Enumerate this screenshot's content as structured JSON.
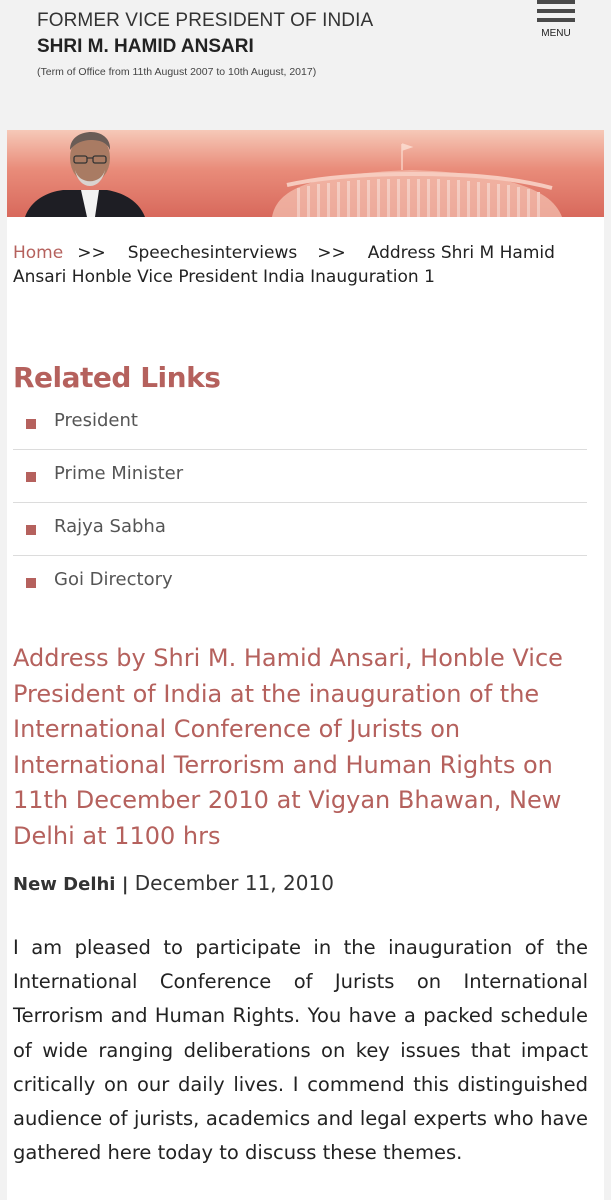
{
  "header": {
    "title": "FORMER VICE PRESIDENT OF INDIA",
    "name": "SHRI M. HAMID ANSARI",
    "term": "(Term of Office from 11th August 2007 to 10th August, 2017)",
    "menu_label": "MENU"
  },
  "colors": {
    "accent": "#b5615d",
    "banner_top": "#f6c9b8",
    "banner_bottom": "#d8695c",
    "background": "#f2f2f2"
  },
  "breadcrumb": {
    "home": "Home",
    "separator": ">>",
    "section": "Speechesinterviews",
    "current": "Address Shri M Hamid Ansari Honble Vice President India Inauguration 1"
  },
  "related": {
    "title": "Related Links",
    "items": [
      {
        "label": "President"
      },
      {
        "label": "Prime Minister"
      },
      {
        "label": "Rajya Sabha"
      },
      {
        "label": "Goi Directory"
      }
    ]
  },
  "article": {
    "title": "Address by Shri M. Hamid Ansari, Honble Vice President of India at the inauguration of the International Conference of Jurists on International Terrorism and Human Rights on 11th December 2010 at Vigyan Bhawan, New Delhi at 1100 hrs",
    "place": "New Delhi",
    "divider": "|",
    "date": "December 11, 2010",
    "body": "I am pleased to participate in the inauguration of the International Conference of Jurists on International Terrorism and Human Rights. You have a packed schedule of wide ranging deliberations on key issues that impact critically on our daily lives. I commend this distinguished audience of jurists, academics and legal experts who have gathered here today to discuss these themes."
  }
}
